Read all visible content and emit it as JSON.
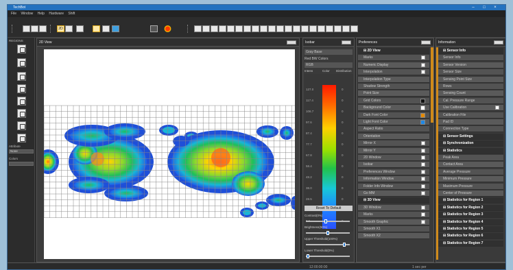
{
  "window": {
    "title": "TechBot"
  },
  "menu": [
    "File",
    "Window",
    "Help",
    "Hardware",
    "Shift"
  ],
  "toolbar": {
    "buttons": [
      "sensor-icon",
      "save-icon",
      "open-icon",
      "view-2d-icon",
      "table-icon",
      "frame-icon",
      "grid-icon",
      "chart-icon",
      "export-icon",
      "camera-icon",
      "logo-icon"
    ],
    "view_2d_label": "2D",
    "right_buttons": 20
  },
  "leftbar": {
    "heading": "REGIONS",
    "tools": [
      "cursor-icon",
      "line-icon",
      "circle-icon",
      "polygon-icon",
      "rect-icon",
      "stroke-icon",
      "fill-icon",
      "brush-icon"
    ],
    "attribute_label": "Attribute",
    "attribute_value": "None",
    "colors_label": "Colors"
  },
  "view2d": {
    "title": "2D View"
  },
  "indicator": {
    "title": "Isobar",
    "mode": "Gray Base",
    "colors": "Red BW Colors",
    "scheme": "RGB",
    "columns": [
      "Intens",
      "Color",
      "Distribution"
    ],
    "ticks": [
      {
        "v": "127.0",
        "p": "0"
      },
      {
        "v": "117.4",
        "p": "0"
      },
      {
        "v": "106.7",
        "p": "0"
      },
      {
        "v": "97.6",
        "p": "0"
      },
      {
        "v": "87.4",
        "p": "0"
      },
      {
        "v": "77.7",
        "p": "0"
      },
      {
        "v": "67.8",
        "p": "0"
      },
      {
        "v": "58.4",
        "p": "0"
      },
      {
        "v": "48.2",
        "p": "0"
      },
      {
        "v": "38.0",
        "p": "0"
      },
      {
        "v": "28.5",
        "p": "0"
      },
      {
        "v": "19.0",
        "p": "0"
      },
      {
        "v": "9.5",
        "p": "0"
      }
    ],
    "reset_label": "Reset To Default",
    "sliders": [
      {
        "label": "Contrast(0%)",
        "value": 0.45
      },
      {
        "label": "Brightness(50%)",
        "value": 0.5
      },
      {
        "label": "Upper Threshold(100%)",
        "value": 0.9
      },
      {
        "label": "Lower Threshold(0%)",
        "value": 0.02
      }
    ]
  },
  "preferences": {
    "title": "Preferences",
    "items": [
      {
        "kind": "cat",
        "label": "2D View"
      },
      {
        "kind": "val",
        "label": "Marks",
        "cb": true
      },
      {
        "kind": "val",
        "label": "Numeric Display",
        "cb": true
      },
      {
        "kind": "val",
        "label": "Interpolation",
        "cb": true
      },
      {
        "kind": "val",
        "label": "Interpolation Type",
        "cb": false
      },
      {
        "kind": "val",
        "label": "Shadow Strength",
        "cb": false
      },
      {
        "kind": "val",
        "label": "Point Size",
        "cb": false
      },
      {
        "kind": "val",
        "label": "Grid Colors",
        "swatch": "#111111"
      },
      {
        "kind": "val",
        "label": "Background Color",
        "swatch": "#ffffff"
      },
      {
        "kind": "val",
        "label": "Dark Font Color",
        "swatch": "#e68a00"
      },
      {
        "kind": "val",
        "label": "Light Font Color",
        "swatch": "#1e88e5"
      },
      {
        "kind": "val",
        "label": "Aspect Ratio",
        "cb": false
      },
      {
        "kind": "val",
        "label": "Orientation",
        "cb": false
      },
      {
        "kind": "val",
        "label": "Mirror X",
        "cb": true
      },
      {
        "kind": "val",
        "label": "Mirror Y",
        "cb": true
      },
      {
        "kind": "val",
        "label": "2D Window",
        "cb": true
      },
      {
        "kind": "val",
        "label": "Isobar",
        "cb": true
      },
      {
        "kind": "val",
        "label": "Preferences Window",
        "cb": true
      },
      {
        "kind": "val",
        "label": "Information Window",
        "cb": true
      },
      {
        "kind": "val",
        "label": "Folder Info Window",
        "cb": true
      },
      {
        "kind": "val",
        "label": "Go MM",
        "cb": true
      },
      {
        "kind": "cat",
        "label": "3D View"
      },
      {
        "kind": "val",
        "label": "3D Window",
        "cb": true
      },
      {
        "kind": "val",
        "label": "Marks",
        "cb": true
      },
      {
        "kind": "val",
        "label": "Smooth Graphic",
        "cb": true
      },
      {
        "kind": "val",
        "label": "Smooth X1",
        "cb": false
      },
      {
        "kind": "val",
        "label": "Smooth X2",
        "cb": false
      }
    ]
  },
  "information": {
    "title": "Information",
    "items": [
      {
        "kind": "cat",
        "label": "Sensor Info"
      },
      {
        "kind": "val",
        "label": "Sensor Info"
      },
      {
        "kind": "val",
        "label": "Sensor Version"
      },
      {
        "kind": "val",
        "label": "Sensor Size"
      },
      {
        "kind": "val",
        "label": "Sensing Point Size"
      },
      {
        "kind": "val",
        "label": "Rows"
      },
      {
        "kind": "val",
        "label": "Sensing Count"
      },
      {
        "kind": "val",
        "label": "Cal. Pressure Range"
      },
      {
        "kind": "val",
        "label": "Use Calibration",
        "cb": true
      },
      {
        "kind": "val",
        "label": "Calibration File"
      },
      {
        "kind": "val",
        "label": "Pad ID"
      },
      {
        "kind": "val",
        "label": "Connection Type"
      },
      {
        "kind": "cat",
        "label": "Sensor Settings"
      },
      {
        "kind": "cat",
        "label": "Synchronization"
      },
      {
        "kind": "cat",
        "label": "Statistics"
      },
      {
        "kind": "val",
        "label": "Peak Area"
      },
      {
        "kind": "val",
        "label": "Contact Area"
      },
      {
        "kind": "val",
        "label": "Average Pressure"
      },
      {
        "kind": "val",
        "label": "Minimum Pressure"
      },
      {
        "kind": "val",
        "label": "Maximum Pressure"
      },
      {
        "kind": "val",
        "label": "Center of Pressure"
      },
      {
        "kind": "cat",
        "label": "Statistics for Region 1"
      },
      {
        "kind": "cat",
        "label": "Statistics for Region 2"
      },
      {
        "kind": "cat",
        "label": "Statistics for Region 3"
      },
      {
        "kind": "cat",
        "label": "Statistics for Region 4"
      },
      {
        "kind": "cat",
        "label": "Statistics for Region 5"
      },
      {
        "kind": "cat",
        "label": "Statistics for Region 6"
      },
      {
        "kind": "cat",
        "label": "Statistics for Region 7"
      }
    ]
  },
  "status": {
    "left": "",
    "middle": "12:00:00:00",
    "right": "1 sec per"
  },
  "colors": {
    "accent": "#2372bf",
    "highlight": "#d08a1a"
  }
}
